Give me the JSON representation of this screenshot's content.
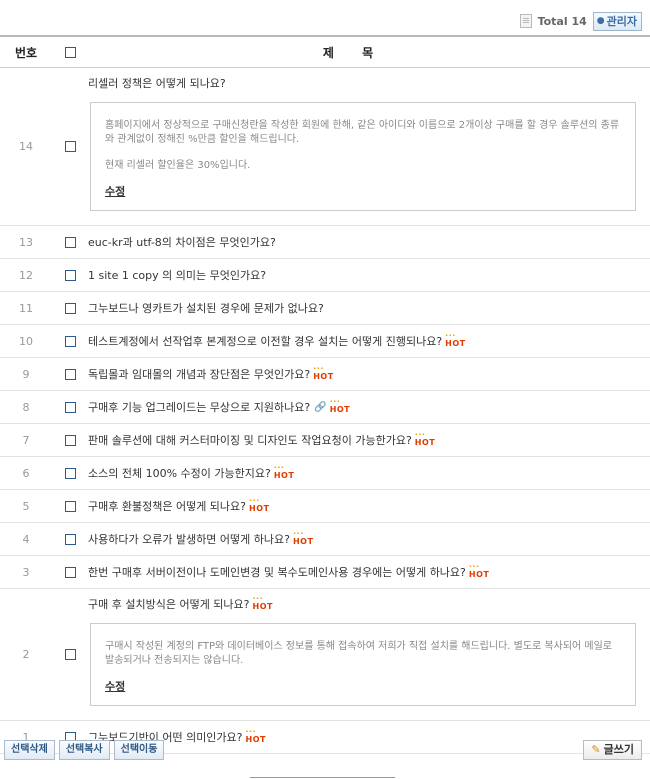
{
  "header": {
    "total_label": "Total 14",
    "admin_label": "관리자"
  },
  "table": {
    "col_no": "번호",
    "col_title": "제 목",
    "rows": [
      {
        "no": "14",
        "title": "리셀러 정책은 어떻게 되나요?",
        "expanded": true,
        "answer": [
          "홈페이지에서 정상적으로 구매신청란을 작성한 회원에 한해, 같은 아이디와 이름으로 2개이상 구매를 할 경우 솔루션의 종류와 관계없이 정해진 %만큼 할인을 해드립니다.",
          "현재 리셀러 할인율은 30%입니다."
        ],
        "edit": "수정"
      },
      {
        "no": "13",
        "title": "euc-kr과 utf-8의 차이점은 무엇인가요?"
      },
      {
        "no": "12",
        "title": "1 site 1 copy 의 의미는 무엇인가요?"
      },
      {
        "no": "11",
        "title": "그누보드나 영카트가 설치된 경우에 문제가 없나요?"
      },
      {
        "no": "10",
        "title": "테스트계정에서 선작업후 본계정으로 이전할 경우 설치는 어떻게 진행되나요?",
        "hot": "HOT"
      },
      {
        "no": "9",
        "title": "독립몰과 임대몰의 개념과 장단점은 무엇인가요?",
        "hot": "HOT"
      },
      {
        "no": "8",
        "title": "구매후 기능 업그레이드는 무상으로 지원하나요?",
        "hot": "HOT",
        "attachment": true
      },
      {
        "no": "7",
        "title": "판매 솔루션에 대해 커스터마이징 및 디자인도 작업요청이 가능한가요?",
        "hot": "HOT"
      },
      {
        "no": "6",
        "title": "소스의 전체 100% 수정이 가능한지요?",
        "hot": "HOT"
      },
      {
        "no": "5",
        "title": "구매후 환불정책은 어떻게 되나요?",
        "hot": "HOT"
      },
      {
        "no": "4",
        "title": "사용하다가 오류가 발생하면 어떻게 하나요?",
        "hot": "HOT"
      },
      {
        "no": "3",
        "title": "한번 구매후 서버이전이나 도메인변경 및 복수도메인사용 경우에는 어떻게 하나요?",
        "hot": "HOT"
      },
      {
        "no": "2",
        "title": "구매 후 설치방식은 어떻게 되나요?",
        "hot": "HOT",
        "expanded": true,
        "answer": [
          "구매시 작성된 계정의 FTP와 데이터베이스 정보를 통해 접속하여 저희가 직접 설치를 해드립니다. 별도로 복사되어 메일로 발송되거나 전송되지는 않습니다."
        ],
        "edit": "수정"
      },
      {
        "no": "1",
        "title": "그누보드기반이 어떤 의미인가요?",
        "hot": "HOT"
      }
    ]
  },
  "footer": {
    "delete_label": "선택삭제",
    "copy_label": "선택복사",
    "move_label": "선택이동",
    "write_label": "글쓰기"
  },
  "icons": {
    "admin": "pin-icon",
    "write": "pencil-icon",
    "attachment": "paperclip-icon",
    "total": "document-icon"
  }
}
